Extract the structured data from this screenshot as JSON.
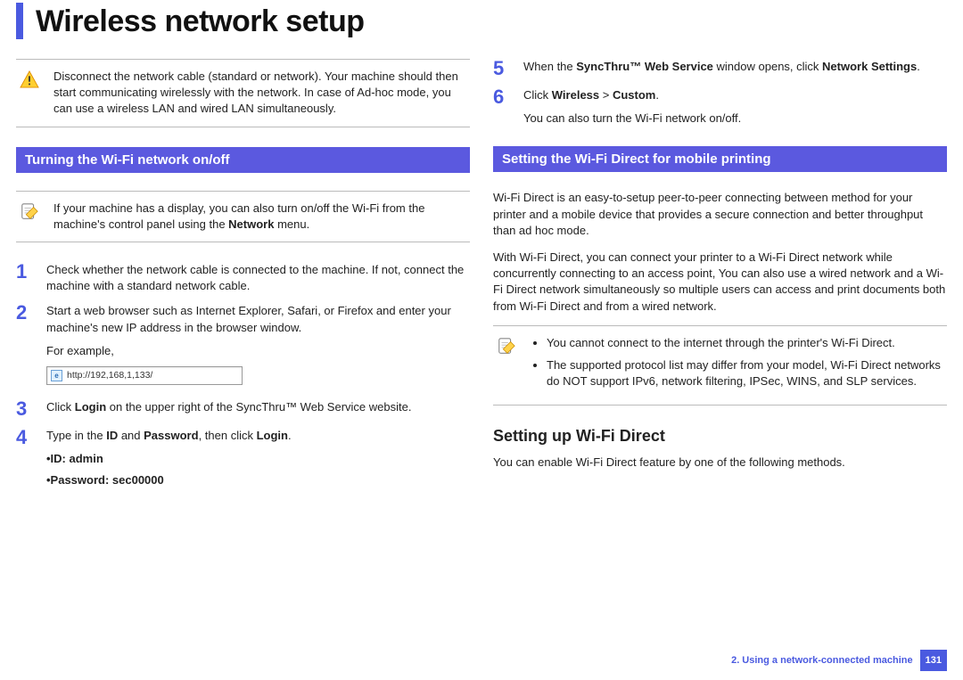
{
  "title": "Wireless network setup",
  "left": {
    "warning": "Disconnect the network cable (standard or network). Your machine should then start communicating wirelessly with the network. In case of Ad-hoc mode, you can use a wireless LAN and wired LAN simultaneously.",
    "sectionBar": "Turning the Wi-Fi network on/off",
    "note": {
      "t1": "If your machine has a display, you can also turn on/off the Wi-Fi from the machine's control panel using the ",
      "b1": "Network",
      "t2": " menu."
    },
    "steps": {
      "s1": "Check whether the network cable is connected to the machine. If not, connect the machine with a standard network cable.",
      "s2": "Start a web browser such as Internet Explorer, Safari, or Firefox and enter your machine's new IP address in the browser window.",
      "s2_example": "For example,",
      "url": "http://192,168,1,133/",
      "s3_a": "Click ",
      "s3_b": "Login",
      "s3_c": " on the upper right of the SyncThru™ Web Service website.",
      "s4_a": "Type in the ",
      "s4_b": "ID",
      "s4_c": " and ",
      "s4_d": "Password",
      "s4_e": ", then click ",
      "s4_f": "Login",
      "s4_g": ".",
      "cred_id": "•ID: admin",
      "cred_pw": "•Password: sec00000"
    }
  },
  "right": {
    "steps_56": {
      "s5_a": "When the ",
      "s5_b": "SyncThru™ Web Service",
      "s5_c": " window opens, click ",
      "s5_d": "Network Settings",
      "s5_e": ".",
      "s6_a": "Click ",
      "s6_b": "Wireless",
      "s6_c": " > ",
      "s6_d": "Custom",
      "s6_e": ".",
      "s6_sub": "You can also turn the Wi-Fi network on/off."
    },
    "sectionBar": "Setting the Wi-Fi Direct for mobile printing",
    "para1": "Wi-Fi Direct is an easy-to-setup peer-to-peer connecting between method for your printer and a mobile device that provides a secure connection and better throughput than ad hoc mode.",
    "para2": "With Wi-Fi Direct, you can connect your printer to a Wi-Fi Direct network while concurrently connecting to an access point, You can also use a wired network and a Wi-Fi Direct network simultaneously so multiple users can access and print documents both from Wi-Fi Direct and from a wired network.",
    "note_bullets": {
      "b1": "You cannot connect to the internet through the printer's Wi-Fi Direct.",
      "b2": "The supported protocol list may differ from your model, Wi-Fi Direct networks do NOT support IPv6, network filtering, IPSec, WINS, and SLP services."
    },
    "subhead": "Setting up Wi-Fi Direct",
    "para3": "You can enable Wi-Fi Direct feature by one of the following methods."
  },
  "footer": {
    "label": "2.  Using a network-connected machine",
    "page": "131"
  }
}
